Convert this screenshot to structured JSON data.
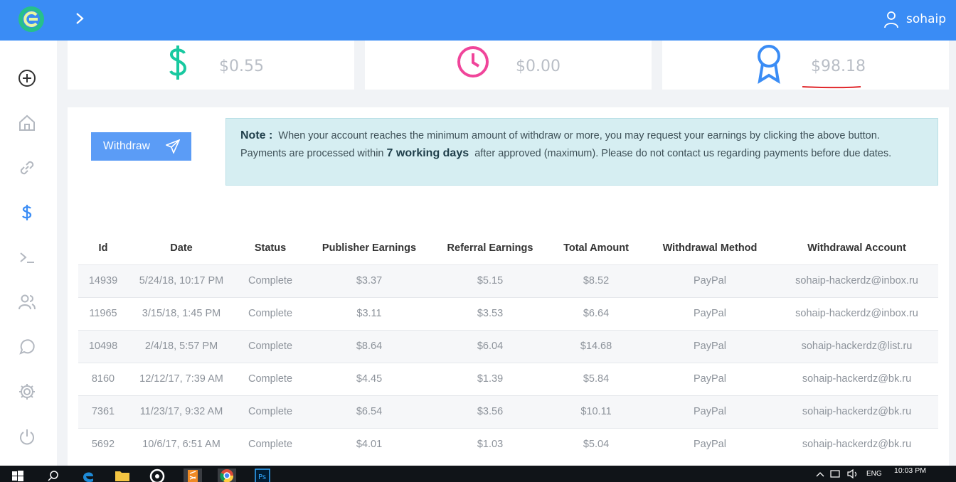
{
  "header": {
    "user_name": "sohaip",
    "colors": {
      "bar": "#3a8cf5",
      "logo": "#27c08a"
    },
    "icons": [
      "logo-icon",
      "chevron-right-icon",
      "user-icon"
    ]
  },
  "sidebar": {
    "items": [
      {
        "name": "add-icon",
        "active": true
      },
      {
        "name": "home-icon"
      },
      {
        "name": "link-icon"
      },
      {
        "name": "dollar-icon",
        "active": true
      },
      {
        "name": "terminal-icon"
      },
      {
        "name": "users-icon"
      },
      {
        "name": "chat-icon"
      },
      {
        "name": "gear-icon"
      },
      {
        "name": "power-icon"
      }
    ]
  },
  "stats": [
    {
      "icon": "dollar-icon",
      "value": "$0.55",
      "color": "#18c9a0"
    },
    {
      "icon": "clock-icon",
      "value": "$0.00",
      "color": "#f0459a"
    },
    {
      "icon": "award-icon",
      "value": "$98.18",
      "color": "#3a8cf5"
    }
  ],
  "withdraw": {
    "label": "Withdraw"
  },
  "note": {
    "lead": "Note :",
    "text1": "When your account reaches the minimum amount of withdraw or more, you may request your earnings by clicking the above button. Payments are processed within",
    "bold": "7 working days",
    "text2": "after approved (maximum). Please do not contact us regarding payments before due dates."
  },
  "table": {
    "headers": [
      "Id",
      "Date",
      "Status",
      "Publisher Earnings",
      "Referral Earnings",
      "Total Amount",
      "Withdrawal Method",
      "Withdrawal Account"
    ],
    "rows": [
      [
        "14939",
        "5/24/18, 10:17 PM",
        "Complete",
        "$3.37",
        "$5.15",
        "$8.52",
        "PayPal",
        "sohaip-hackerdz@inbox.ru"
      ],
      [
        "11965",
        "3/15/18, 1:45 PM",
        "Complete",
        "$3.11",
        "$3.53",
        "$6.64",
        "PayPal",
        "sohaip-hackerdz@inbox.ru"
      ],
      [
        "10498",
        "2/4/18, 5:57 PM",
        "Complete",
        "$8.64",
        "$6.04",
        "$14.68",
        "PayPal",
        "sohaip-hackerdz@list.ru"
      ],
      [
        "8160",
        "12/12/17, 7:39 AM",
        "Complete",
        "$4.45",
        "$1.39",
        "$5.84",
        "PayPal",
        "sohaip-hackerdz@bk.ru"
      ],
      [
        "7361",
        "11/23/17, 9:32 AM",
        "Complete",
        "$6.54",
        "$3.56",
        "$10.11",
        "PayPal",
        "sohaip-hackerdz@bk.ru"
      ],
      [
        "5692",
        "10/6/17, 6:51 AM",
        "Complete",
        "$4.01",
        "$1.03",
        "$5.04",
        "PayPal",
        "sohaip-hackerdz@bk.ru"
      ]
    ]
  },
  "taskbar": {
    "language": "ENG",
    "time": "10:03 PM",
    "apps": [
      "windows-start-icon",
      "search-icon",
      "edge-icon",
      "folder-icon",
      "app-icon",
      "sublime-icon",
      "chrome-icon",
      "photoshop-icon"
    ]
  }
}
